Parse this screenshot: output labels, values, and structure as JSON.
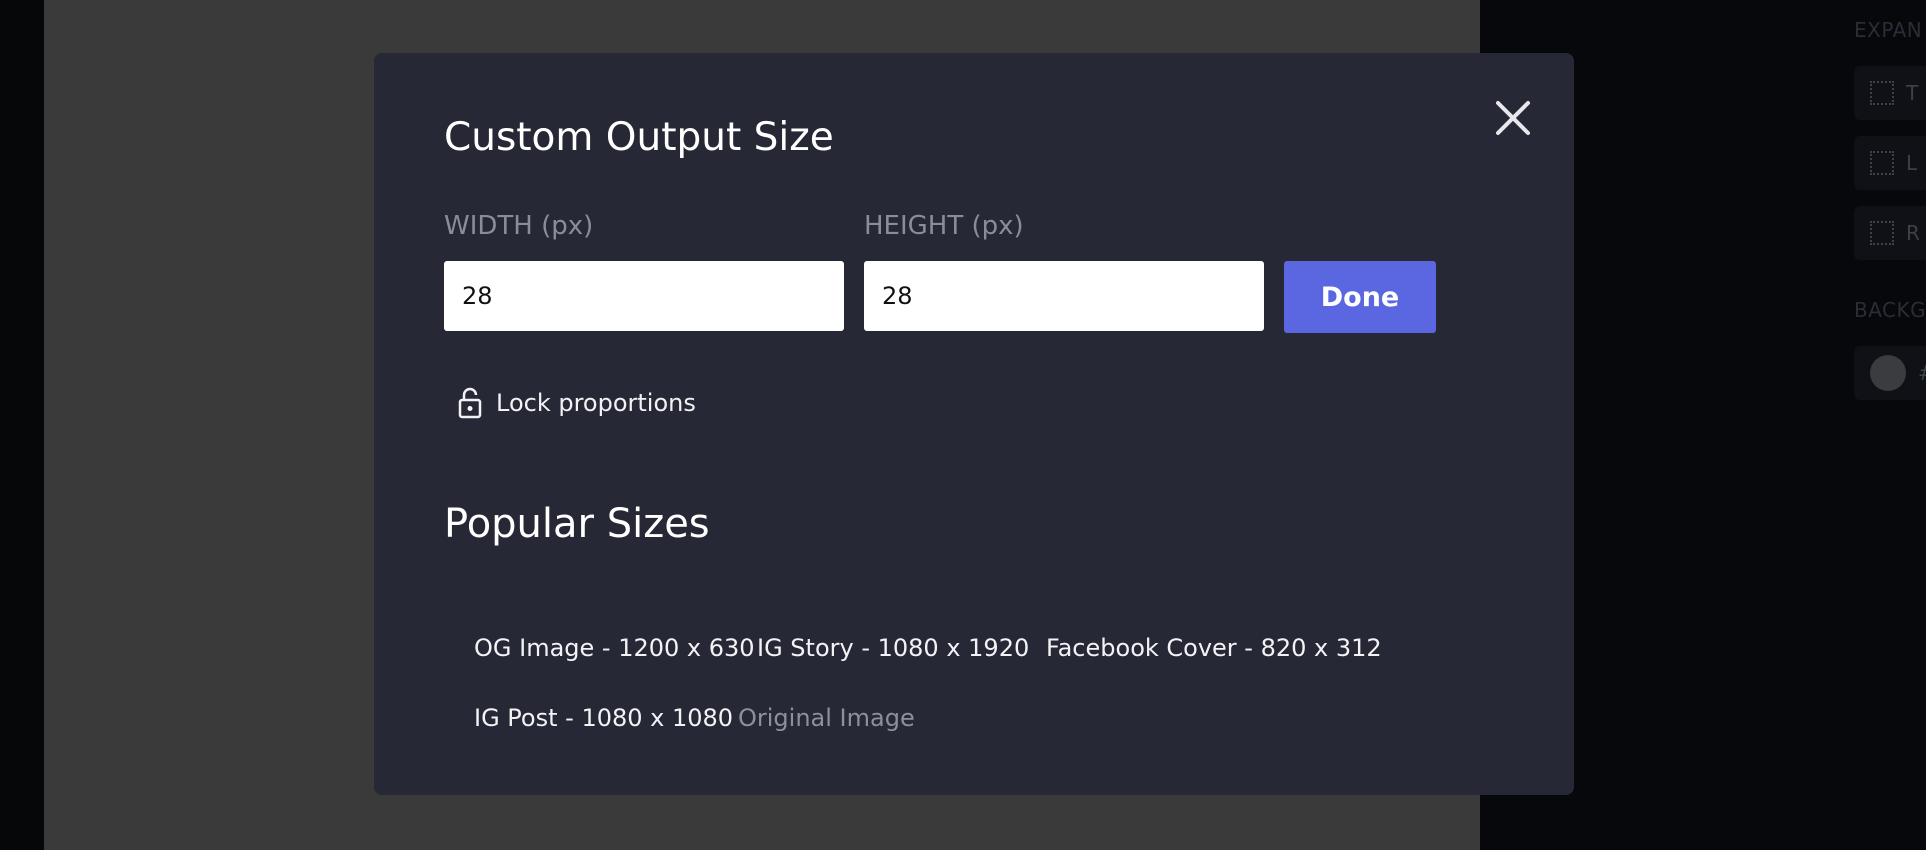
{
  "side_panel": {
    "expand_heading": "EXPAN",
    "expand_items": [
      "T",
      "L",
      "R"
    ],
    "background_heading": "BACKG",
    "background_color_label": "#"
  },
  "modal": {
    "title": "Custom Output Size",
    "width_label": "WIDTH (px)",
    "height_label": "HEIGHT (px)",
    "width_value": "28",
    "height_value": "28",
    "done_label": "Done",
    "lock_label": "Lock proportions",
    "popular_title": "Popular Sizes",
    "sizes": [
      "OG Image - 1200 x 630",
      "IG Story - 1080 x 1920",
      "Facebook Cover - 820 x 312",
      "IG Post - 1080 x 1080",
      "Original Image"
    ]
  },
  "colors": {
    "modal_bg": "#262835",
    "accent": "#5b67e0",
    "canvas_bg": "#3a3a3a"
  }
}
